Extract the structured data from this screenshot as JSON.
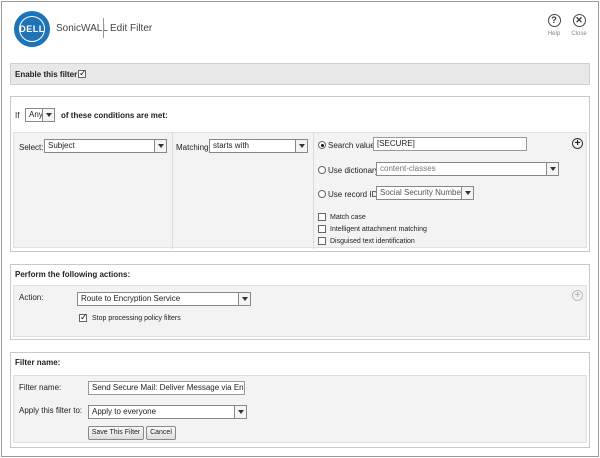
{
  "header": {
    "brand_logo": "DELL",
    "brand_name": "SonicWALL",
    "title": "Edit Filter",
    "help_label": "Help",
    "close_label": "Close",
    "help_icon": "?",
    "close_icon": "✕"
  },
  "enable": {
    "label": "Enable this filter:",
    "checked": true
  },
  "conditions": {
    "if_label": "If",
    "match_value": "Any",
    "match_suffix": "of these conditions are met:",
    "select_label": "Select:",
    "select_value": "Subject",
    "matching_label": "Matching:",
    "matching_value": "starts with",
    "search_value_label": "Search value:",
    "search_value": "[SECURE]",
    "use_dictionary_label": "Use dictionary:",
    "dictionary_value": "content-classes",
    "use_record_id_label": "Use record ID:",
    "record_id_value": "Social Security Number",
    "match_case_label": "Match case",
    "intelligent_label": "Intelligent attachment matching",
    "disguised_label": "Disguised text identification",
    "add_icon": "+"
  },
  "actions": {
    "title": "Perform the following actions:",
    "action_label": "Action:",
    "action_value": "Route to Encryption Service",
    "stop_processing_label": "Stop processing policy filters",
    "add_icon": "+"
  },
  "filter_name": {
    "title": "Filter name:",
    "name_label": "Filter name:",
    "name_value": "Send Secure Mail: Deliver Message via Enc",
    "apply_label": "Apply this filter to:",
    "apply_value": "Apply to everyone",
    "save_label": "Save This Filter",
    "cancel_label": "Cancel"
  }
}
